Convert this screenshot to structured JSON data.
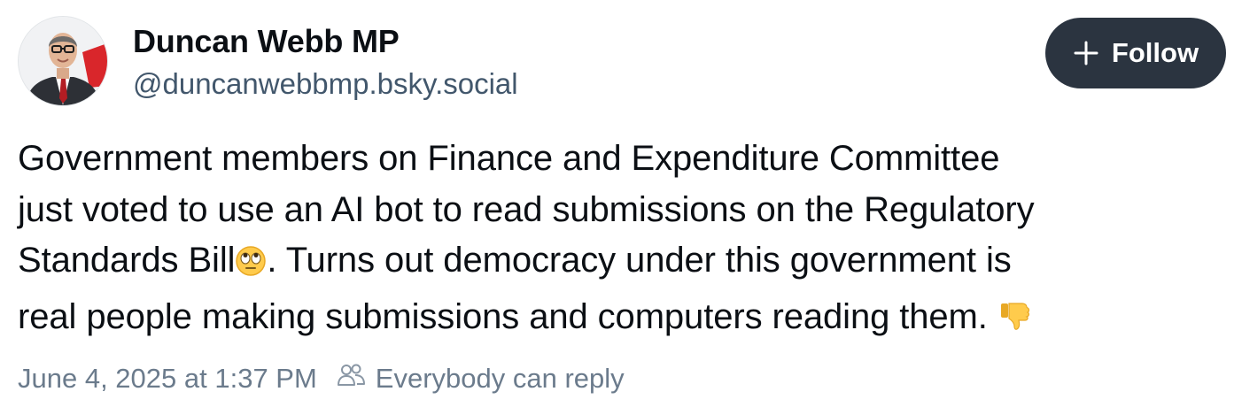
{
  "author": {
    "display_name": "Duncan Webb MP",
    "handle": "@duncanwebbmp.bsky.social",
    "avatar_icon": "profile-photo"
  },
  "follow_button": {
    "label": "Follow",
    "icon": "plus-icon",
    "background": "#2b3440"
  },
  "post": {
    "lines": [
      "Government members on Finance and Expenditure Committee",
      "just voted to use an AI bot to read submissions on the Regulatory",
      "Standards Bill",
      ".  Turns out democracy under this government is",
      "real people making submissions and computers reading them. "
    ],
    "emojis": [
      "face-with-rolling-eyes",
      "thumbs-down"
    ]
  },
  "meta": {
    "timestamp": "June 4, 2025 at 1:37 PM",
    "reply_setting": "Everybody can reply",
    "reply_icon": "people-icon"
  },
  "colors": {
    "text": "#0b0f14",
    "secondary_text": "#42576c",
    "muted_text": "#6b7b8c"
  }
}
